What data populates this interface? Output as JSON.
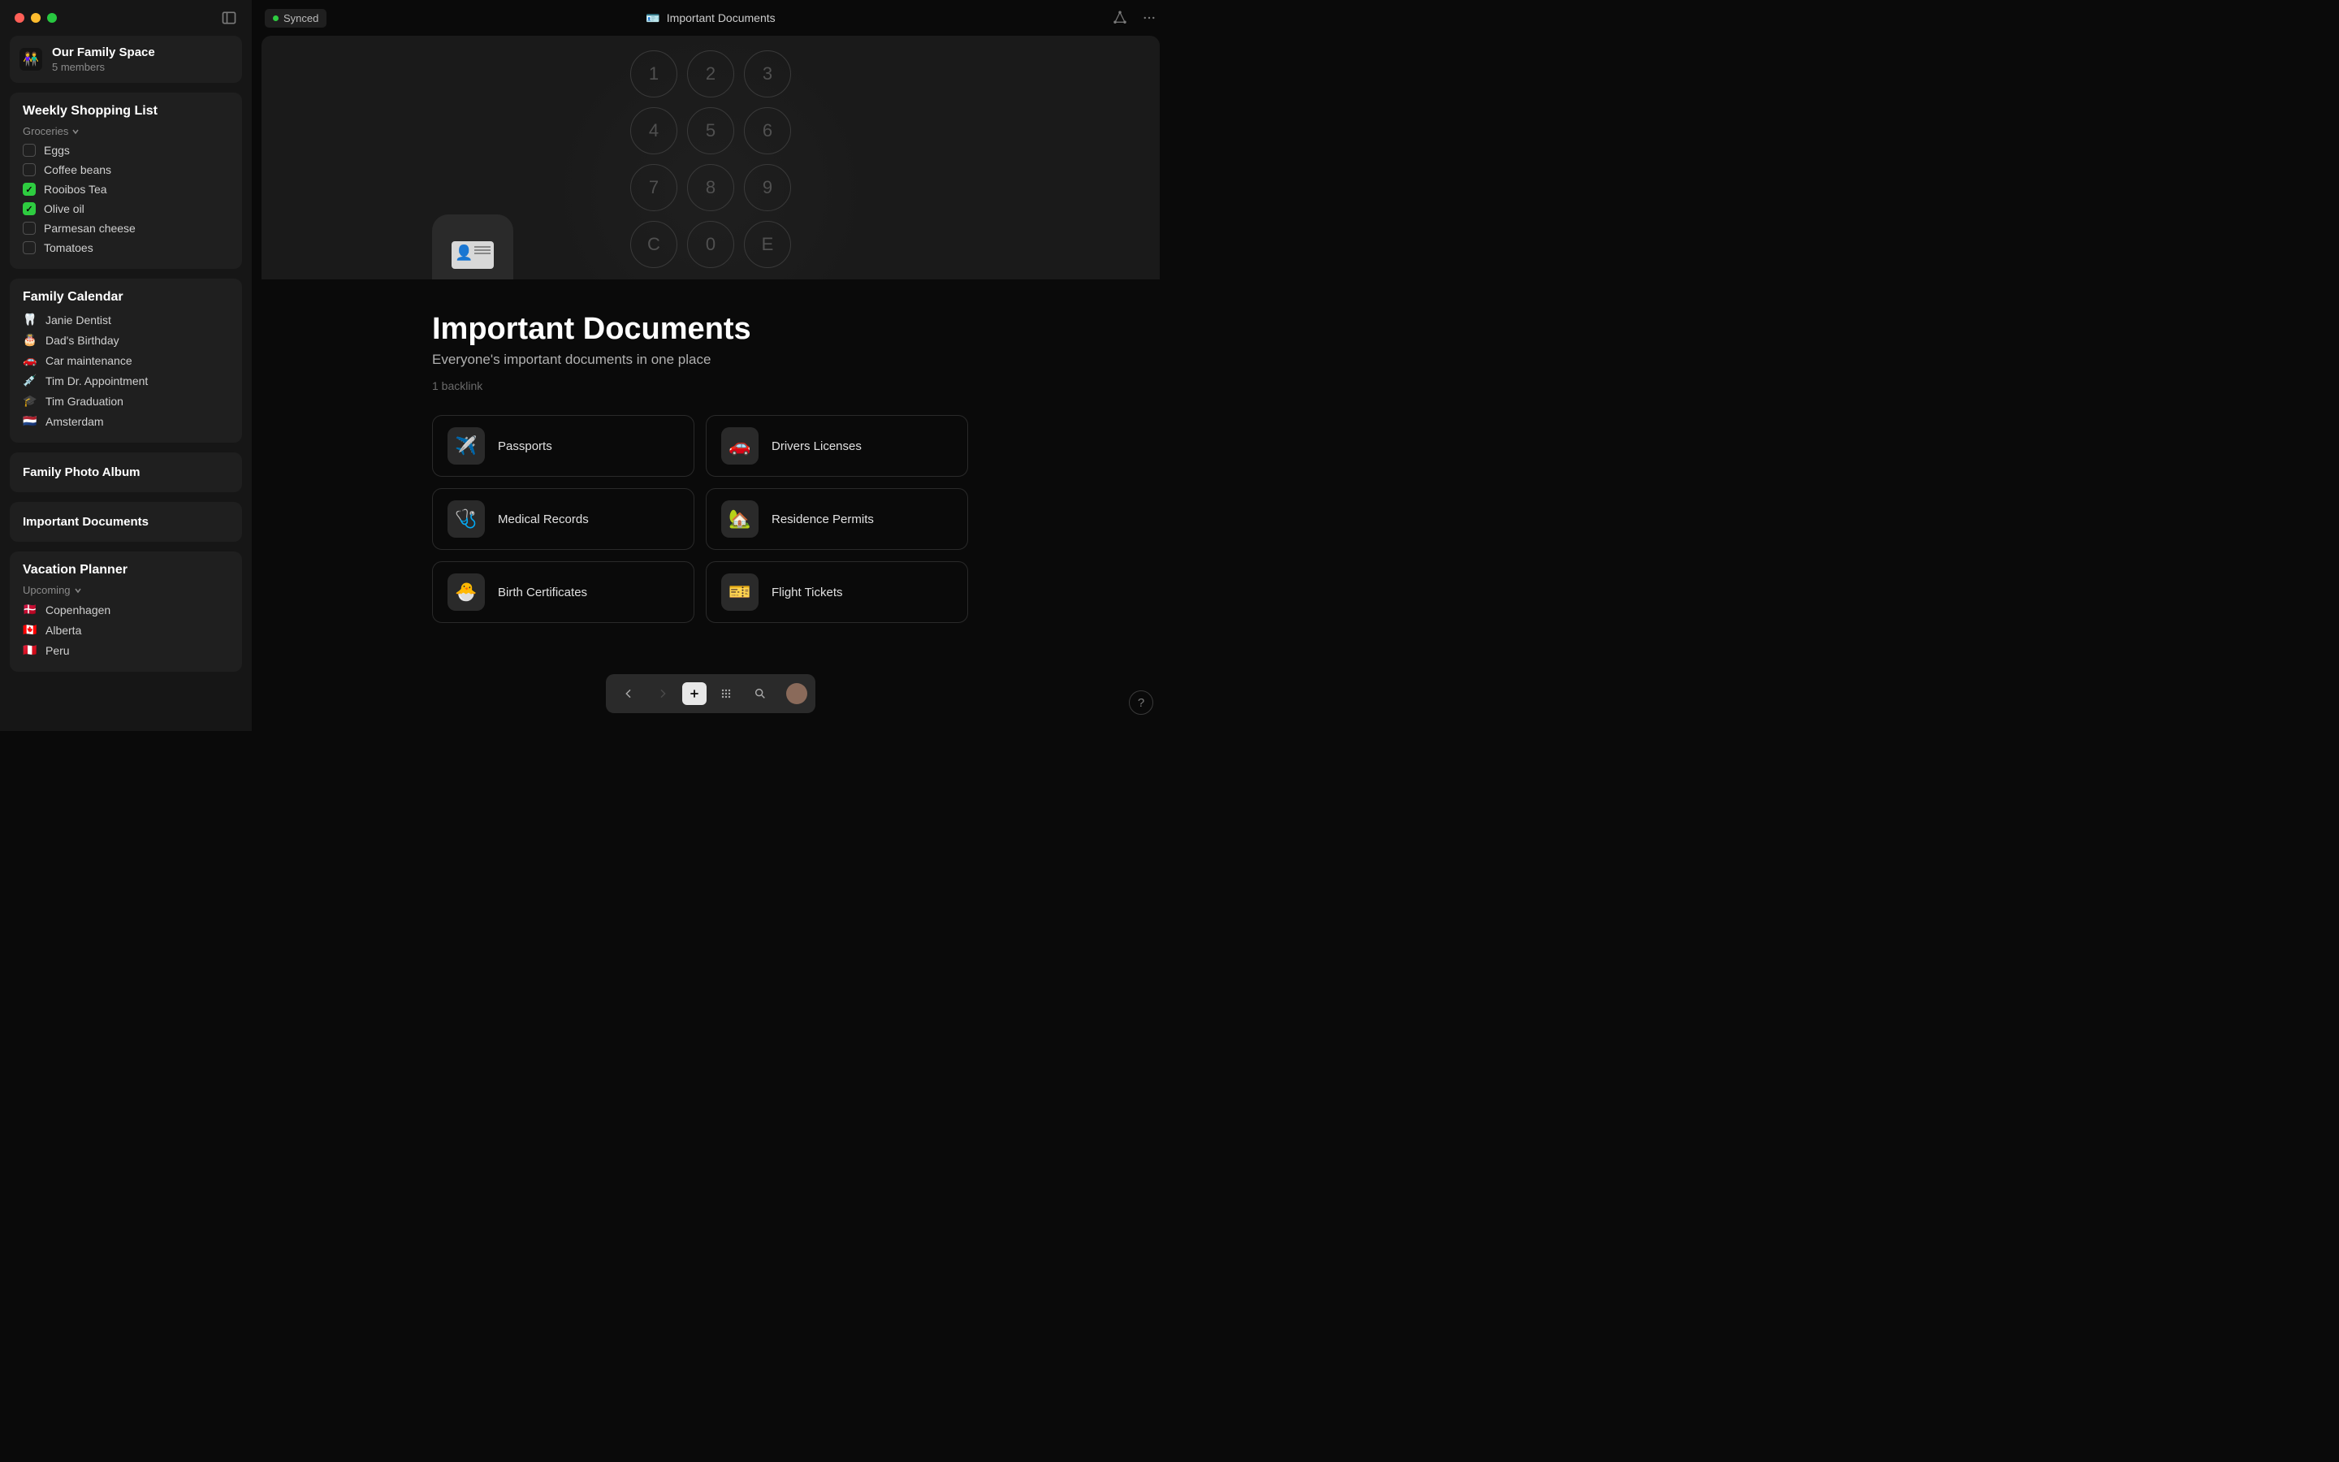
{
  "sync_label": "Synced",
  "breadcrumb_icon": "🪪",
  "breadcrumb_title": "Important Documents",
  "workspace": {
    "icon": "👫",
    "name": "Our Family Space",
    "subtitle": "5 members"
  },
  "sidebar": {
    "shopping": {
      "title": "Weekly Shopping List",
      "subhead": "Groceries",
      "items": [
        {
          "label": "Eggs",
          "checked": false
        },
        {
          "label": "Coffee beans",
          "checked": false
        },
        {
          "label": "Rooibos Tea",
          "checked": true
        },
        {
          "label": "Olive oil",
          "checked": true
        },
        {
          "label": "Parmesan cheese",
          "checked": false
        },
        {
          "label": "Tomatoes",
          "checked": false
        }
      ]
    },
    "calendar": {
      "title": "Family Calendar",
      "items": [
        {
          "emoji": "🦷",
          "label": "Janie Dentist"
        },
        {
          "emoji": "🎂",
          "label": "Dad's Birthday"
        },
        {
          "emoji": "🚗",
          "label": "Car maintenance"
        },
        {
          "emoji": "💉",
          "label": "Tim Dr. Appointment"
        },
        {
          "emoji": "🎓",
          "label": "Tim Graduation"
        },
        {
          "emoji": "🇳🇱",
          "label": "Amsterdam"
        }
      ]
    },
    "photo_album": "Family Photo Album",
    "important_docs": "Important Documents",
    "vacation": {
      "title": "Vacation Planner",
      "subhead": "Upcoming",
      "items": [
        {
          "emoji": "🇩🇰",
          "label": "Copenhagen"
        },
        {
          "emoji": "🇨🇦",
          "label": "Alberta"
        },
        {
          "emoji": "🇵🇪",
          "label": "Peru"
        }
      ]
    }
  },
  "page": {
    "title": "Important Documents",
    "subtitle": "Everyone's important documents in one place",
    "backlink": "1 backlink",
    "docs": [
      {
        "emoji": "✈️",
        "label": "Passports"
      },
      {
        "emoji": "🚗",
        "label": "Drivers Licenses"
      },
      {
        "emoji": "🩺",
        "label": "Medical Records"
      },
      {
        "emoji": "🏡",
        "label": "Residence Permits"
      },
      {
        "emoji": "🐣",
        "label": "Birth Certificates"
      },
      {
        "emoji": "🎫",
        "label": "Flight Tickets"
      }
    ]
  },
  "keypad": [
    "1",
    "2",
    "3",
    "4",
    "5",
    "6",
    "7",
    "8",
    "9",
    "C",
    "0",
    "E"
  ],
  "help_label": "?"
}
